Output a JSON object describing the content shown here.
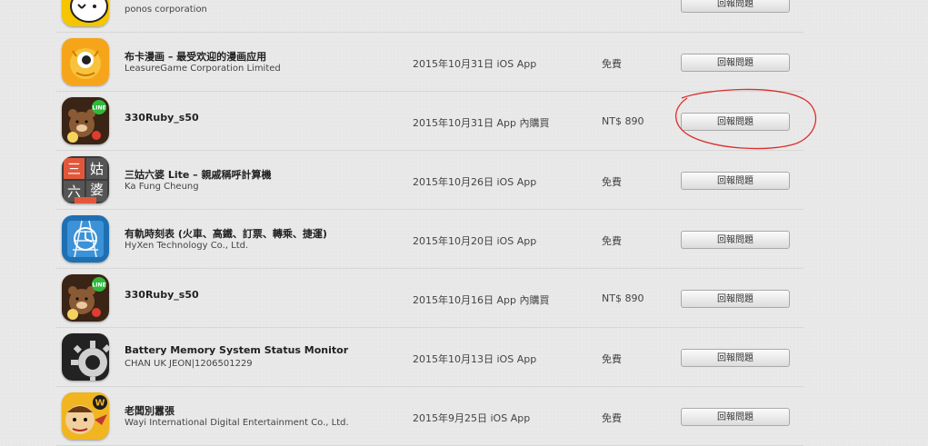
{
  "colors": {
    "annotation": "#d9302e",
    "button_border": "#a9a9a9",
    "divider": "#d7d7d7"
  },
  "purchases": [
    {
      "title": "",
      "developer": "ponos corporation",
      "date": "",
      "type": "",
      "price": "",
      "button": "回報問題",
      "icon": "white-cat-icon"
    },
    {
      "title": "布卡漫画 – 最受欢迎的漫画应用",
      "developer": "LeasureGame Corporation Limited",
      "date": "2015年10月31日",
      "type": "iOS App",
      "price": "免費",
      "button": "回報問題",
      "icon": "yellow-monster-icon"
    },
    {
      "title": "330Ruby_s50",
      "developer": "",
      "date": "2015年10月31日",
      "type": "App 內購買",
      "price": "NT$ 890",
      "button": "回報問題",
      "icon": "line-bear-icon"
    },
    {
      "title": "三姑六婆 Lite – 親戚稱呼計算機",
      "developer": "Ka Fung Cheung",
      "date": "2015年10月26日",
      "type": "iOS App",
      "price": "免費",
      "button": "回報問題",
      "icon": "chinese-characters-icon"
    },
    {
      "title": "有軌時刻表 (火車、高鐵、訂票、轉乘、捷運)",
      "developer": "HyXen Technology Co., Ltd.",
      "date": "2015年10月20日",
      "type": "iOS App",
      "price": "免費",
      "button": "回報問題",
      "icon": "clock-rail-icon"
    },
    {
      "title": "330Ruby_s50",
      "developer": "",
      "date": "2015年10月16日",
      "type": "App 內購買",
      "price": "NT$ 890",
      "button": "回報問題",
      "icon": "line-bear-icon"
    },
    {
      "title": "Battery Memory System Status Monitor",
      "developer": "CHAN UK JEON|1206501229",
      "date": "2015年10月13日",
      "type": "iOS App",
      "price": "免費",
      "button": "回報問題",
      "icon": "gear-icon"
    },
    {
      "title": "老闆別囂張",
      "developer": "Wayi International Digital Entertainment Co., Ltd.",
      "date": "2015年9月25日",
      "type": "iOS App",
      "price": "免費",
      "button": "回報問題",
      "icon": "boss-cartoon-icon"
    }
  ]
}
